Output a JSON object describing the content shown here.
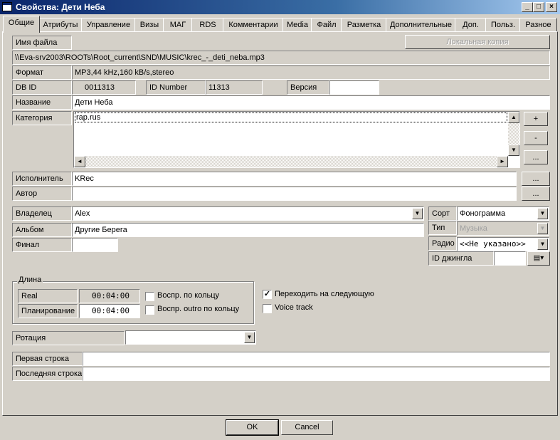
{
  "window": {
    "title": "Свойства: Дети Неба",
    "min": "_",
    "max": "□",
    "close": "×"
  },
  "tabs": [
    "Общие",
    "Атрибуты",
    "Управление",
    "Визы",
    "МАГ",
    "RDS",
    "Комментарии",
    "Media",
    "Файл",
    "Разметка",
    "Дополнительные",
    "Доп.",
    "Польз.",
    "Разное"
  ],
  "file": {
    "label": "Имя файла",
    "local_copy": "Локальная копия",
    "path": "\\\\Eva-srv2003\\ROOTs\\Root_current\\SND\\MUSIC\\krec_-_deti_neba.mp3"
  },
  "format": {
    "label": "Формат",
    "value": "MP3,44 kHz,160 kB/s,stereo"
  },
  "dbid": {
    "label": "DB ID",
    "value": "0011313",
    "idnum_label": "ID Number",
    "idnum_value": "11313",
    "version_label": "Версия",
    "version_value": ""
  },
  "name": {
    "label": "Название",
    "value": "Дети Неба"
  },
  "category": {
    "label": "Категория",
    "value": "rap.rus",
    "add": "+",
    "remove": "-",
    "more": "..."
  },
  "performer": {
    "label": "Исполнитель",
    "value": "KRec",
    "more": "..."
  },
  "author": {
    "label": "Автор",
    "value": "",
    "more": "..."
  },
  "owner": {
    "label": "Владелец",
    "value": "Alex"
  },
  "album": {
    "label": "Альбом",
    "value": "Другие Берега"
  },
  "final": {
    "label": "Финал",
    "value": ""
  },
  "sort": {
    "label": "Сорт",
    "value": "Фонограмма"
  },
  "type": {
    "label": "Тип",
    "value": "Музыка"
  },
  "radio": {
    "label": "Радио",
    "value": "<<Не указано>>"
  },
  "jingle": {
    "label": "ID джингла",
    "value": ""
  },
  "length": {
    "title": "Длина",
    "real_label": "Real",
    "real_value": "00:04:00",
    "plan_label": "Планирование",
    "plan_value": "00:04:00",
    "loop": "Воспр. по кольцу",
    "outro_loop": "Воспр. outro по кольцу"
  },
  "options": {
    "next": "Переходить на следующую",
    "voice": "Voice track"
  },
  "rotation": {
    "label": "Ротация",
    "value": ""
  },
  "lines": {
    "first": "Первая строка",
    "last": "Последняя строка"
  },
  "footer": {
    "ok": "OK",
    "cancel": "Cancel"
  }
}
